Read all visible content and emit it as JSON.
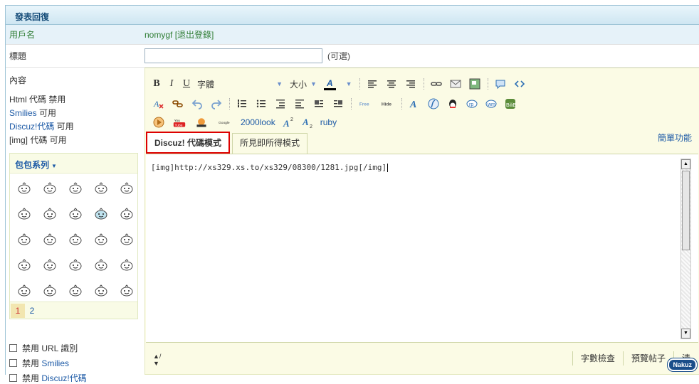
{
  "panel": {
    "title": "發表回復"
  },
  "user_row": {
    "label": "用戶名",
    "username": "nomygf",
    "logout": "[退出登錄]"
  },
  "title_row": {
    "label": "標題",
    "input_value": "",
    "optional": "(可選)"
  },
  "content_row": {
    "label": "內容",
    "permissions": [
      {
        "prefix": "Html",
        "name": " 代碼 禁用"
      },
      {
        "prefix": "Smilies",
        "name": " 可用"
      },
      {
        "prefix": "Discuz!代碼",
        "name": " 可用"
      },
      {
        "prefix": "[img]",
        "name": " 代碼 可用"
      }
    ]
  },
  "smilies": {
    "header": "包包系列",
    "pages": [
      "1",
      "2"
    ],
    "current_page": "1",
    "count": 25
  },
  "options": [
    {
      "prefix": "禁用 ",
      "label": "URL 識別"
    },
    {
      "prefix": "禁用 ",
      "label": "Smilies"
    },
    {
      "prefix": "禁用 ",
      "label": "Discuz!代碼"
    }
  ],
  "toolbar": {
    "bold": "B",
    "italic": "I",
    "underline": "U",
    "font_family": "字體",
    "font_size": "大小",
    "font_color": "A",
    "link_2000look": "2000look",
    "ruby": "ruby",
    "simple_mode": "簡單功能"
  },
  "tabs": {
    "code_mode": "Discuz! 代碼模式",
    "wysiwyg_mode": "所見即所得模式"
  },
  "editor": {
    "content": "[img]http://xs329.xs.to/xs329/08300/1281.jpg[/img]"
  },
  "statusbar": {
    "word_check": "字數檢查",
    "preview": "預覽帖子",
    "clear": "清"
  },
  "watermark": {
    "text": "Nakuz"
  }
}
